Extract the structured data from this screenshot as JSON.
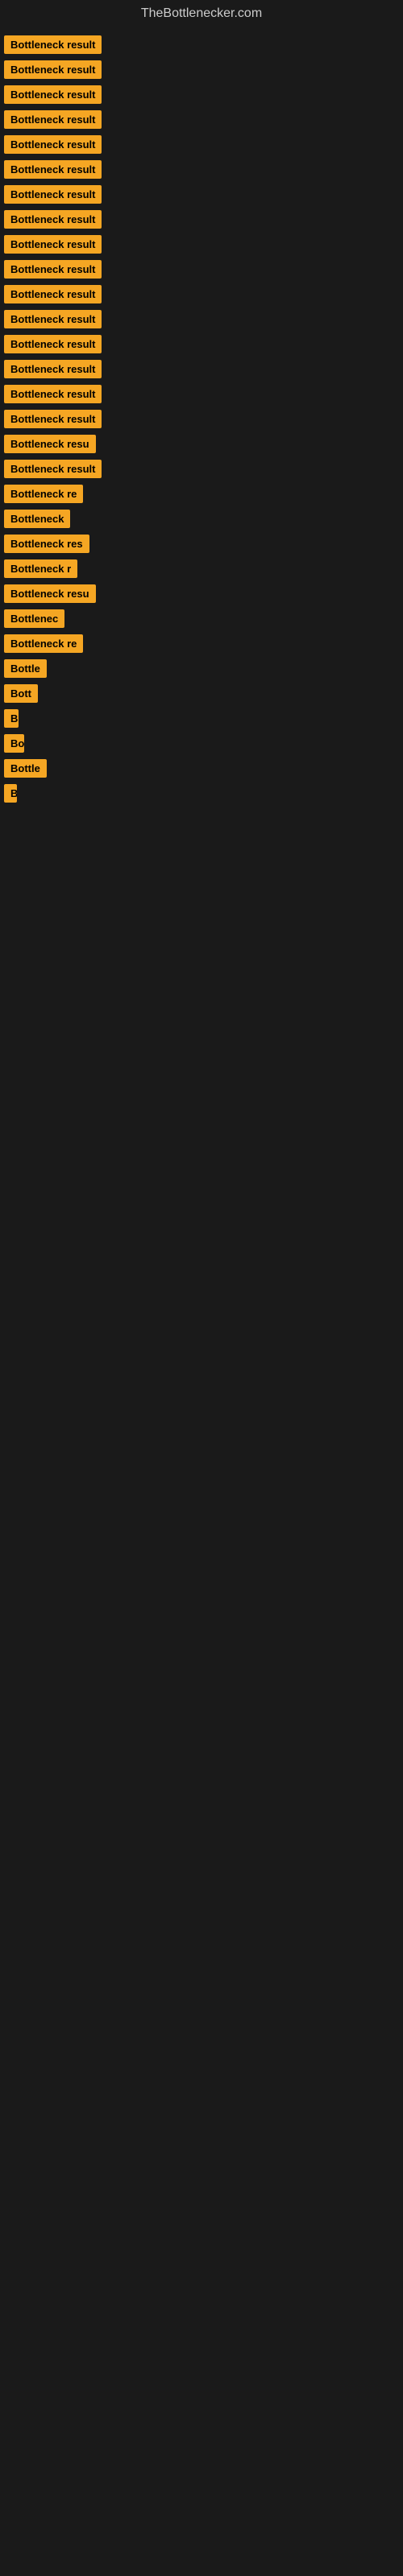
{
  "site": {
    "title": "TheBottlenecker.com"
  },
  "items": [
    {
      "label": "Bottleneck result",
      "width": 130
    },
    {
      "label": "Bottleneck result",
      "width": 130
    },
    {
      "label": "Bottleneck result",
      "width": 130
    },
    {
      "label": "Bottleneck result",
      "width": 130
    },
    {
      "label": "Bottleneck result",
      "width": 130
    },
    {
      "label": "Bottleneck result",
      "width": 130
    },
    {
      "label": "Bottleneck result",
      "width": 130
    },
    {
      "label": "Bottleneck result",
      "width": 130
    },
    {
      "label": "Bottleneck result",
      "width": 130
    },
    {
      "label": "Bottleneck result",
      "width": 130
    },
    {
      "label": "Bottleneck result",
      "width": 130
    },
    {
      "label": "Bottleneck result",
      "width": 130
    },
    {
      "label": "Bottleneck result",
      "width": 130
    },
    {
      "label": "Bottleneck result",
      "width": 130
    },
    {
      "label": "Bottleneck result",
      "width": 130
    },
    {
      "label": "Bottleneck result",
      "width": 130
    },
    {
      "label": "Bottleneck resu",
      "width": 118
    },
    {
      "label": "Bottleneck result",
      "width": 130
    },
    {
      "label": "Bottleneck re",
      "width": 108
    },
    {
      "label": "Bottleneck",
      "width": 90
    },
    {
      "label": "Bottleneck res",
      "width": 112
    },
    {
      "label": "Bottleneck r",
      "width": 100
    },
    {
      "label": "Bottleneck resu",
      "width": 118
    },
    {
      "label": "Bottlenec",
      "width": 85
    },
    {
      "label": "Bottleneck re",
      "width": 108
    },
    {
      "label": "Bottle",
      "width": 55
    },
    {
      "label": "Bott",
      "width": 45
    },
    {
      "label": "B",
      "width": 18
    },
    {
      "label": "Bo",
      "width": 25
    },
    {
      "label": "Bottle",
      "width": 55
    },
    {
      "label": "B",
      "width": 12
    }
  ]
}
